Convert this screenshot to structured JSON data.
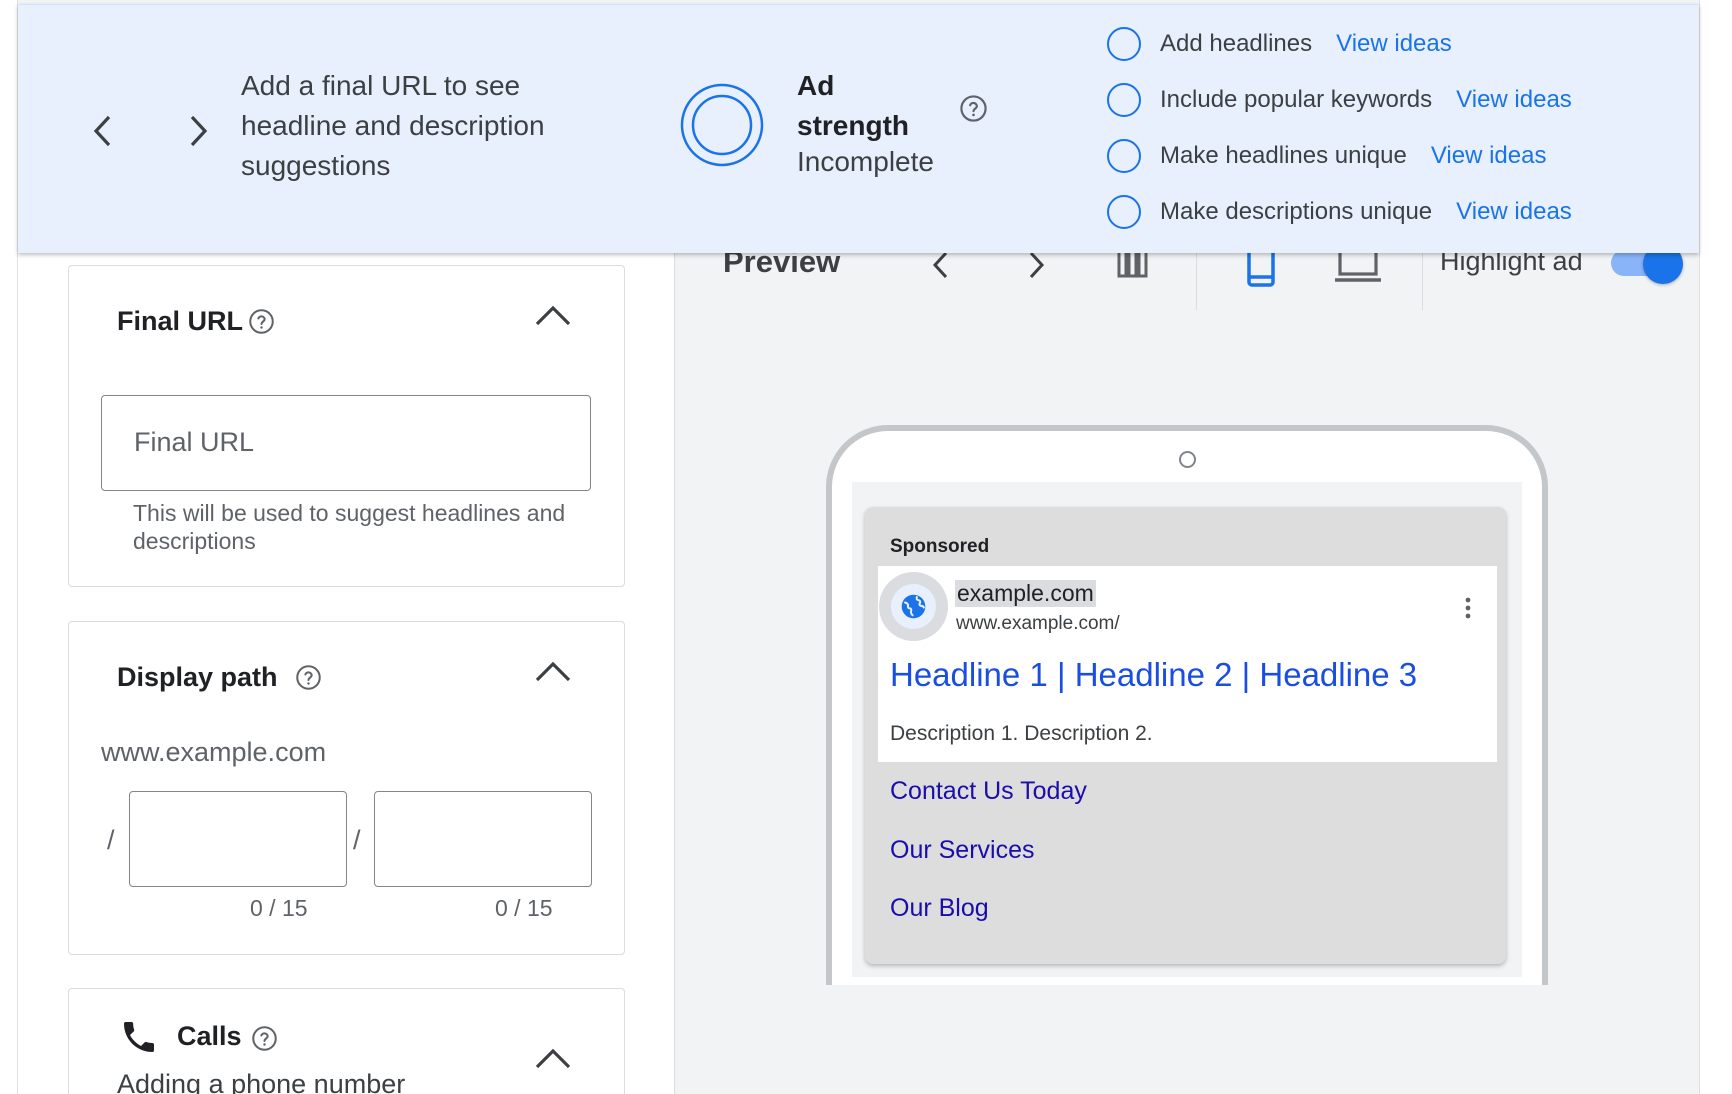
{
  "banner": {
    "message": "Add a final URL to see headline and description suggestions",
    "ad_strength_title": "Ad strength",
    "ad_strength_status": "Incomplete",
    "suggestions": [
      {
        "text": "Add headlines",
        "link": "View ideas"
      },
      {
        "text": "Include popular keywords",
        "link": "View ideas"
      },
      {
        "text": "Make headlines unique",
        "link": "View ideas"
      },
      {
        "text": "Make descriptions unique",
        "link": "View ideas"
      }
    ]
  },
  "final_url": {
    "title": "Final URL",
    "placeholder": "Final URL",
    "hint": "This will be used to suggest headlines and descriptions"
  },
  "display_path": {
    "title": "Display path",
    "base": "www.example.com",
    "slash": "/",
    "counter1": "0 / 15",
    "counter2": "0 / 15"
  },
  "calls": {
    "title": "Calls",
    "subtitle": "Adding a phone number"
  },
  "preview": {
    "title": "Preview",
    "highlight_label": "Highlight ad",
    "highlight_on": true
  },
  "ad": {
    "sponsored": "Sponsored",
    "domain": "example.com",
    "url": "www.example.com/",
    "headline": "Headline 1 | Headline 2 | Headline 3",
    "description": "Description 1. Description 2.",
    "sitelinks": [
      "Contact Us Today",
      "Our Services",
      "Our Blog"
    ]
  },
  "colors": {
    "accent": "#1a73e8",
    "banner_bg": "#e8f0fe",
    "link": "#1a0dab",
    "headline": "#1a4ee0"
  }
}
